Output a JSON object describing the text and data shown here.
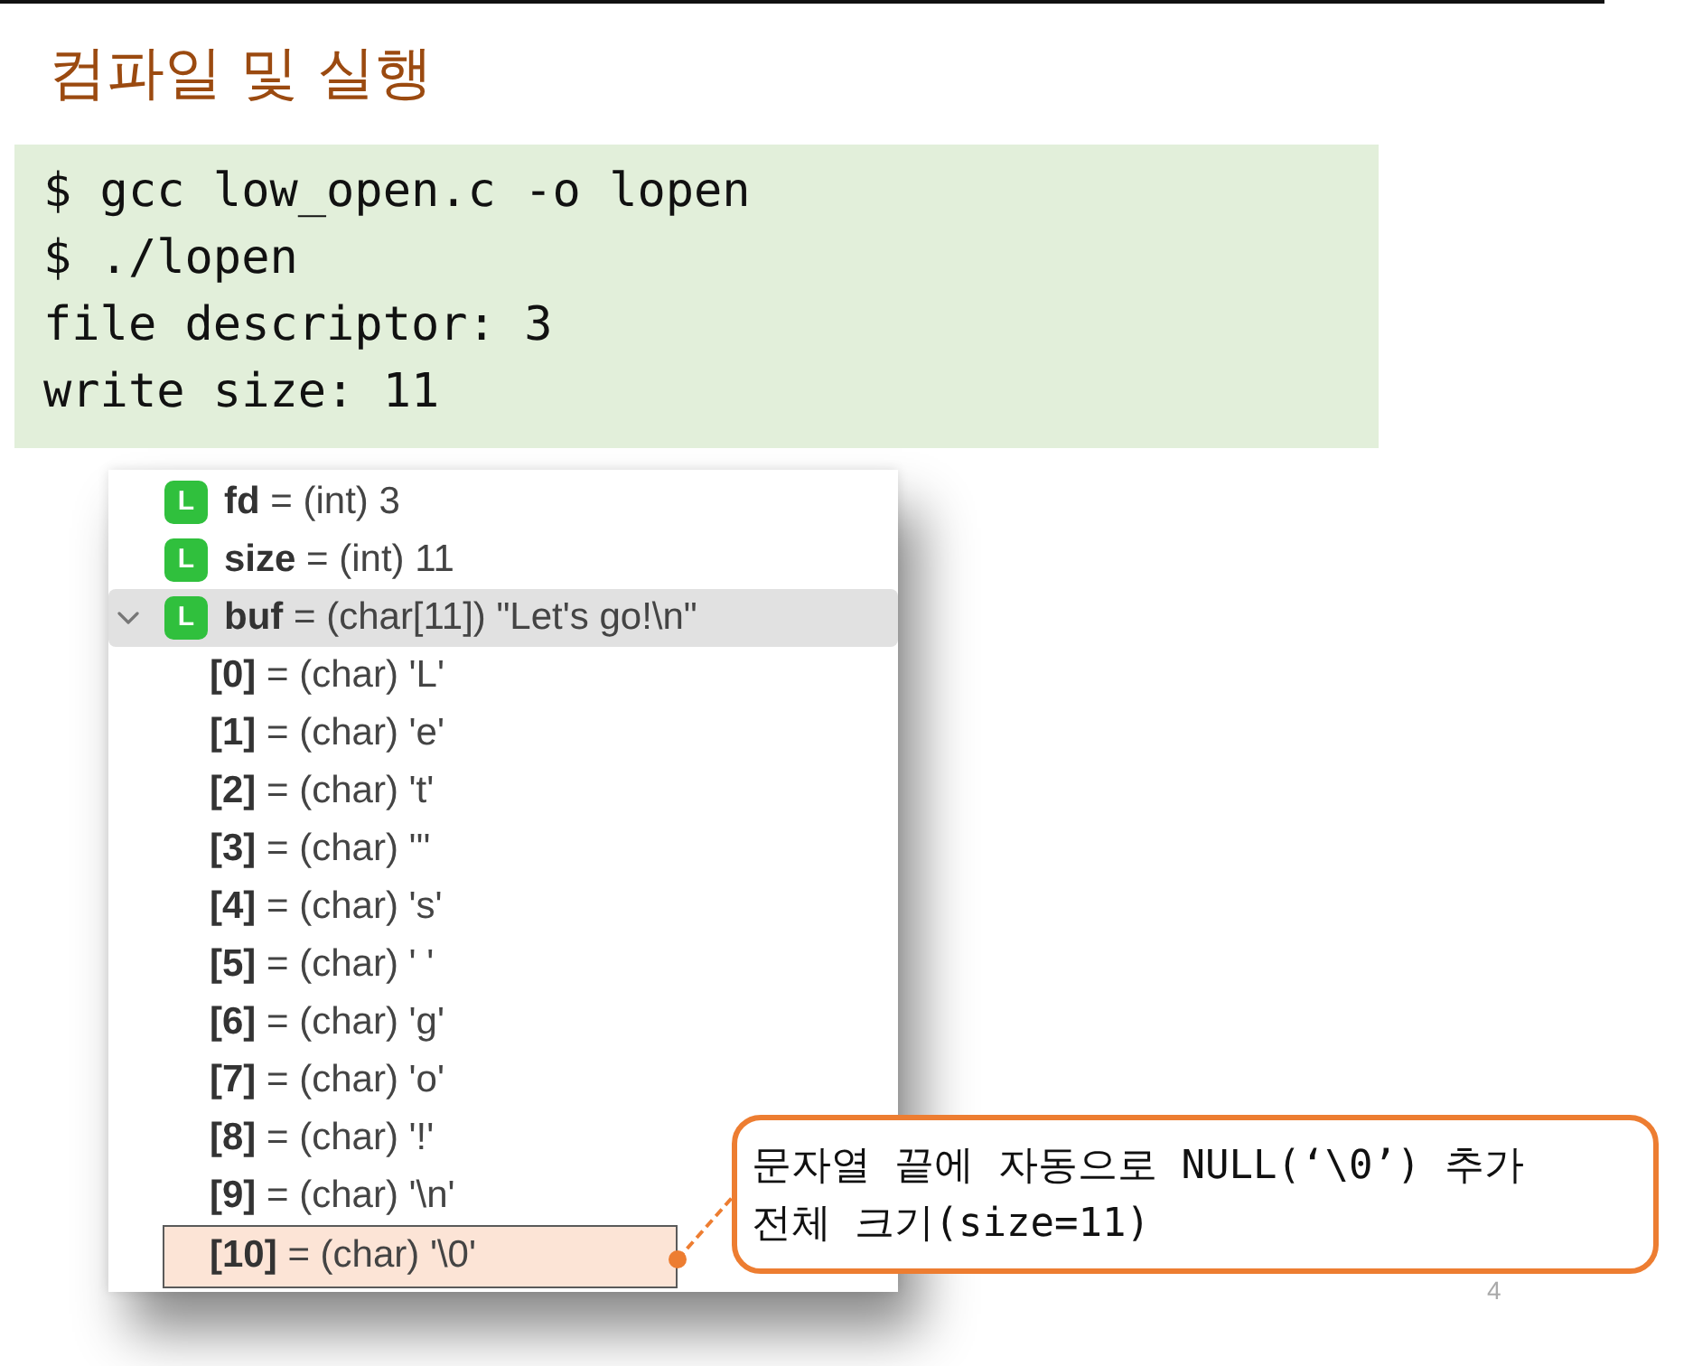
{
  "slide": {
    "title": "컴파일 및 실행",
    "page_number": "4"
  },
  "terminal": {
    "lines": [
      "$ gcc low_open.c -o lopen",
      "$ ./lopen",
      "file descriptor: 3",
      "write size: 11"
    ]
  },
  "debugger": {
    "variables": [
      {
        "badge": "L",
        "text": "**fd** = (int) 3",
        "selected": false
      },
      {
        "badge": "L",
        "text": "**size** = (int) 11",
        "selected": false
      },
      {
        "badge": "L",
        "text": "**buf** = (char[11]) \"Let's go!\\n\"",
        "selected": true,
        "expanded": true,
        "children": [
          {
            "text": "**[0]** = (char) 'L'",
            "highlighted": false
          },
          {
            "text": "**[1]** = (char) 'e'",
            "highlighted": false
          },
          {
            "text": "**[2]** = (char) 't'",
            "highlighted": false
          },
          {
            "text": "**[3]** = (char) '''",
            "highlighted": false
          },
          {
            "text": "**[4]** = (char) 's'",
            "highlighted": false
          },
          {
            "text": "**[5]** = (char) ' '",
            "highlighted": false
          },
          {
            "text": "**[6]** = (char) 'g'",
            "highlighted": false
          },
          {
            "text": "**[7]** = (char) 'o'",
            "highlighted": false
          },
          {
            "text": "**[8]** = (char) '!'",
            "highlighted": false
          },
          {
            "text": "**[9]** = (char) '\\n'",
            "highlighted": false
          },
          {
            "text": "**[10]** = (char) '\\0'",
            "highlighted": true
          }
        ]
      }
    ]
  },
  "callout": {
    "lines": [
      "문자열 끝에 자동으로 NULL(‘\\0’) 추가",
      "전체 크기(size=11)"
    ]
  }
}
